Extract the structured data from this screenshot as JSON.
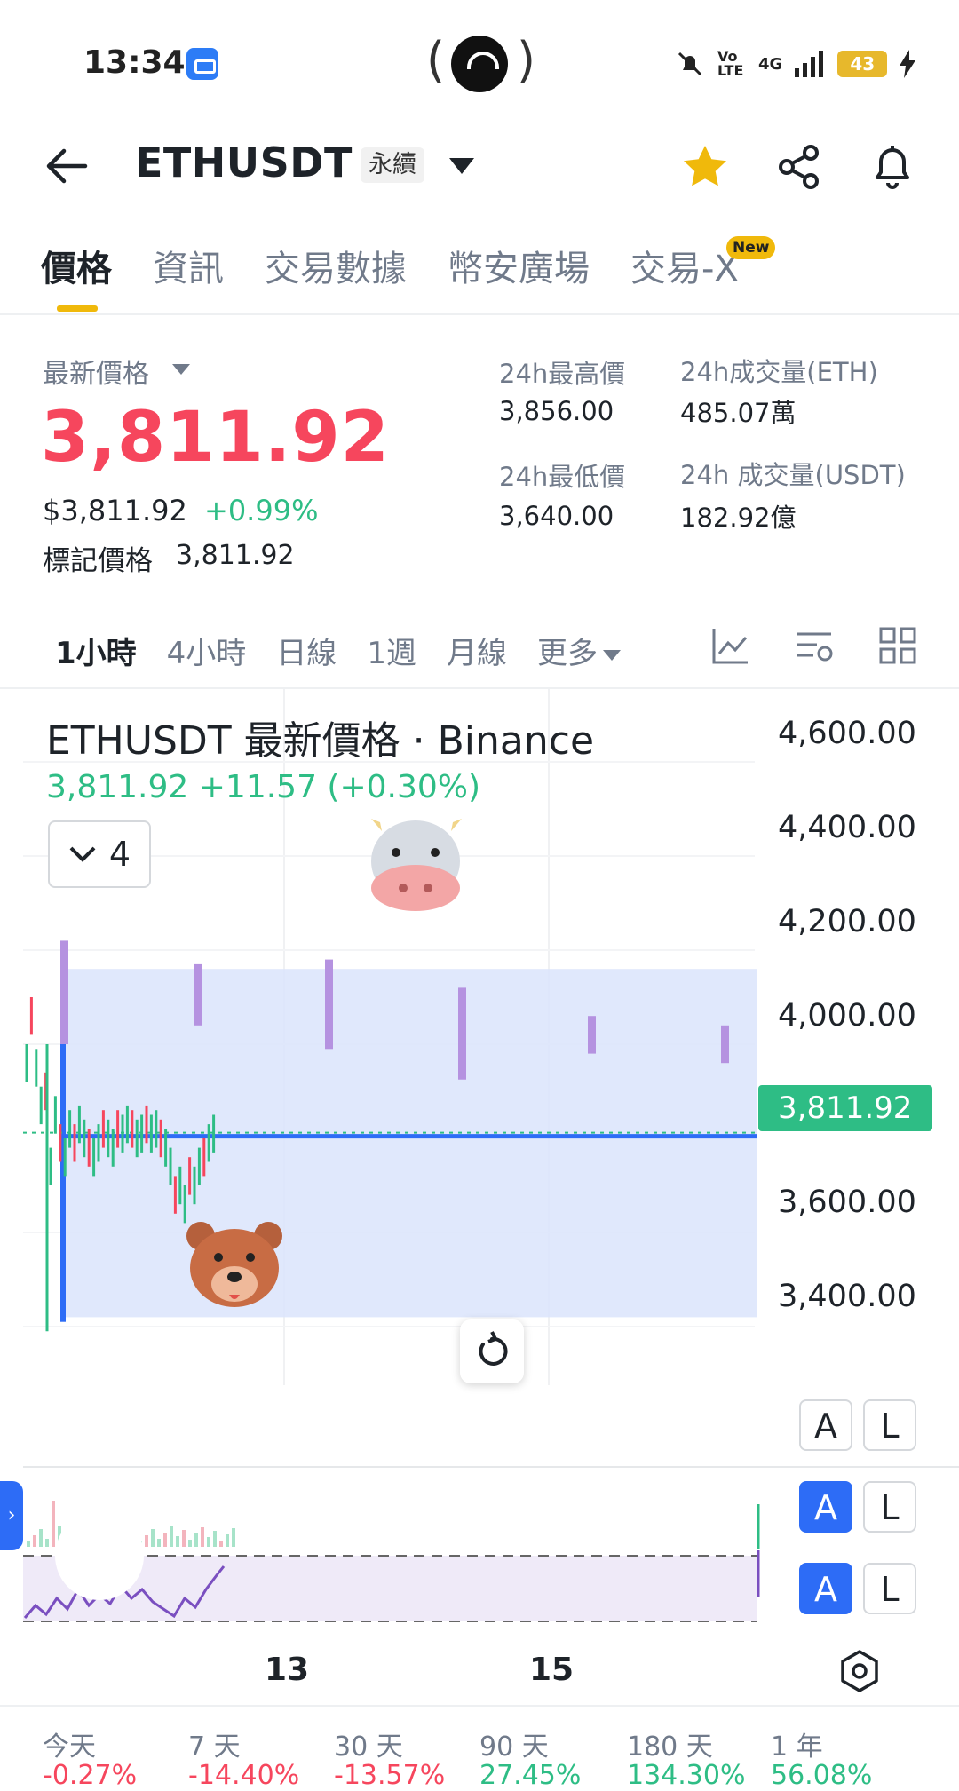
{
  "status_bar": {
    "time": "13:34",
    "network": "4G",
    "volte": "Vo LTE",
    "battery": "43"
  },
  "header": {
    "symbol": "ETHUSDT",
    "contract_type": "永續"
  },
  "tabs": [
    {
      "label": "價格",
      "active": true
    },
    {
      "label": "資訊",
      "active": false
    },
    {
      "label": "交易數據",
      "active": false
    },
    {
      "label": "幣安廣場",
      "active": false
    },
    {
      "label": "交易-X",
      "active": false
    }
  ],
  "new_badge": "New",
  "price": {
    "label": "最新價格",
    "last": "3,811.92",
    "usd": "$3,811.92",
    "change_pct": "+0.99%",
    "mark_label": "標記價格",
    "mark_value": "3,811.92"
  },
  "stats": {
    "high_label": "24h最高價",
    "high_value": "3,856.00",
    "low_label": "24h最低價",
    "low_value": "3,640.00",
    "vol_eth_label": "24h成交量(ETH)",
    "vol_eth_value": "485.07萬",
    "vol_usdt_label": "24h 成交量(USDT)",
    "vol_usdt_value": "182.92億"
  },
  "intervals": [
    {
      "label": "1小時",
      "active": true
    },
    {
      "label": "4小時",
      "active": false
    },
    {
      "label": "日線",
      "active": false
    },
    {
      "label": "1週",
      "active": false
    },
    {
      "label": "月線",
      "active": false
    },
    {
      "label": "更多",
      "active": false
    }
  ],
  "chart": {
    "title": "ETHUSDT 最新價格 · Binance",
    "subtitle": "3,811.92  +11.57 (+0.30%)",
    "indicator_count": "4",
    "current_price_tag": "3,811.92",
    "y_axis_labels": [
      "4,600.00",
      "4,400.00",
      "4,200.00",
      "4,000.00",
      "3,600.00",
      "3,400.00"
    ],
    "x_axis_labels": [
      "13",
      "15"
    ],
    "al_buttons": [
      {
        "a": "A",
        "l": "L",
        "a_active": false
      },
      {
        "a": "A",
        "l": "L",
        "a_active": true
      },
      {
        "a": "A",
        "l": "L",
        "a_active": true
      }
    ],
    "colors": {
      "up": "#2ebd85",
      "down": "#f6465d",
      "accent": "#2d6cf6",
      "brand": "#f0b90b"
    }
  },
  "chart_data": {
    "type": "candlestick",
    "y_ticks": [
      3400,
      3600,
      3800,
      4000,
      4200,
      4400,
      4600
    ],
    "x_ticks": [
      "13",
      "15"
    ],
    "last_price": 3811.92,
    "highlight_band": [
      3420,
      4160
    ],
    "predictions": [
      {
        "low": 4000,
        "high": 4220
      },
      {
        "low": 4040,
        "high": 4170
      },
      {
        "low": 3990,
        "high": 4180
      },
      {
        "low": 3925,
        "high": 4120
      },
      {
        "low": 3980,
        "high": 4060
      },
      {
        "low": 3960,
        "high": 4040
      }
    ]
  },
  "performance": [
    {
      "label": "今天",
      "value": "-0.27%",
      "positive": false
    },
    {
      "label": "7 天",
      "value": "-14.40%",
      "positive": false
    },
    {
      "label": "30 天",
      "value": "-13.57%",
      "positive": false
    },
    {
      "label": "90 天",
      "value": "27.45%",
      "positive": true
    },
    {
      "label": "180 天",
      "value": "134.30%",
      "positive": true
    },
    {
      "label": "1 年",
      "value": "56.08%",
      "positive": true
    }
  ]
}
